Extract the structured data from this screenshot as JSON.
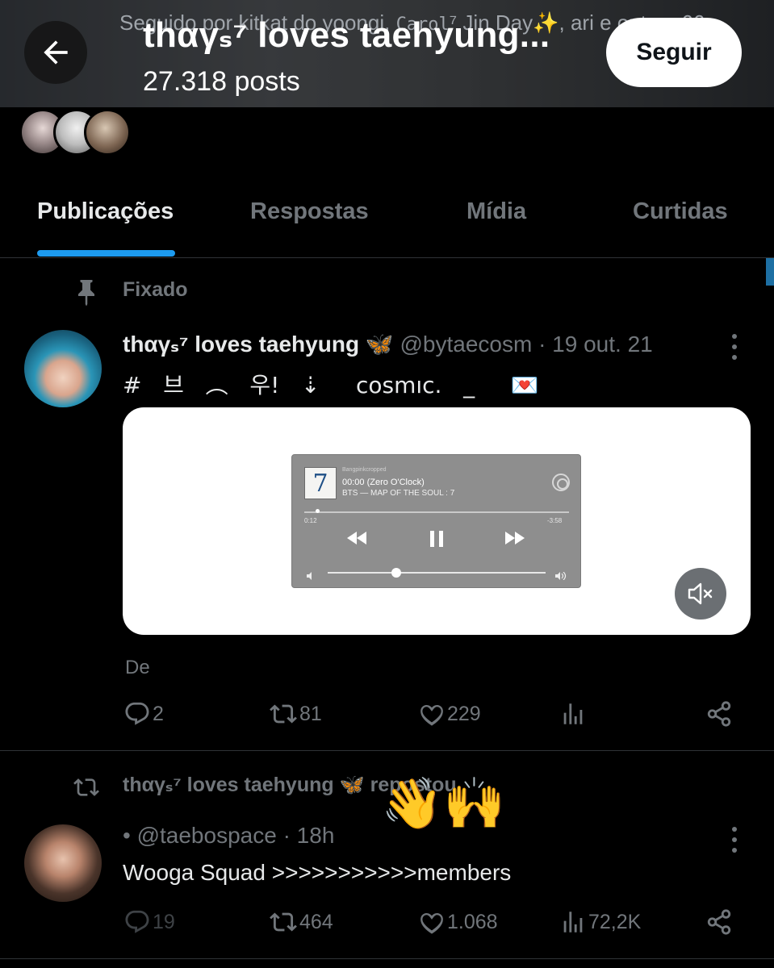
{
  "header": {
    "title": "thαγₛ⁷ loves taehyung...",
    "posts": "27.318 posts",
    "follow_label": "Seguir"
  },
  "followed_by": {
    "prefix": "Seguido por kitkat do yoongi, ",
    "mono_name": "Carol",
    "suffix": "⁷ Jin Day✨, ari e outros 66"
  },
  "tabs": [
    {
      "label": "Publicações",
      "active": true
    },
    {
      "label": "Respostas",
      "active": false
    },
    {
      "label": "Mídia",
      "active": false
    },
    {
      "label": "Curtidas",
      "active": false
    }
  ],
  "pinned": {
    "label": "Fixado",
    "author": "thαγₛ⁷ loves taehyung 🦋",
    "meta": " @bytaecosm · 19 out. 21",
    "text": "#   브   ︵   우!   ⇣     cosmıc.   _     💌",
    "media": {
      "source": "Bangpinkcropped",
      "track_title": "00:00 (Zero O'Clock)",
      "track_artist": "BTS — MAP OF THE SOUL : 7",
      "album_glyph": "7",
      "time_elapsed": "0:12",
      "time_remaining": "-3:58",
      "progress": 0.05,
      "volume": 0.3
    },
    "attribution": "De",
    "stats": {
      "replies": "2",
      "reposts": "81",
      "likes": "229",
      "views": ""
    }
  },
  "repost": {
    "label": "thαγₛ⁷ loves taehyung 🦋 repostou",
    "overlay_emoji": "👋🙌"
  },
  "post2": {
    "meta": "• @taebospace · 18h",
    "text": "Wooga Squad >>>>>>>>>>>members",
    "stats": {
      "replies": "19",
      "reposts": "464",
      "likes": "1.068",
      "views": "72,2K"
    }
  },
  "colors": {
    "accent": "#1d9bf0",
    "muted": "#71767b",
    "text": "#e7e9ea",
    "background": "#000000"
  }
}
